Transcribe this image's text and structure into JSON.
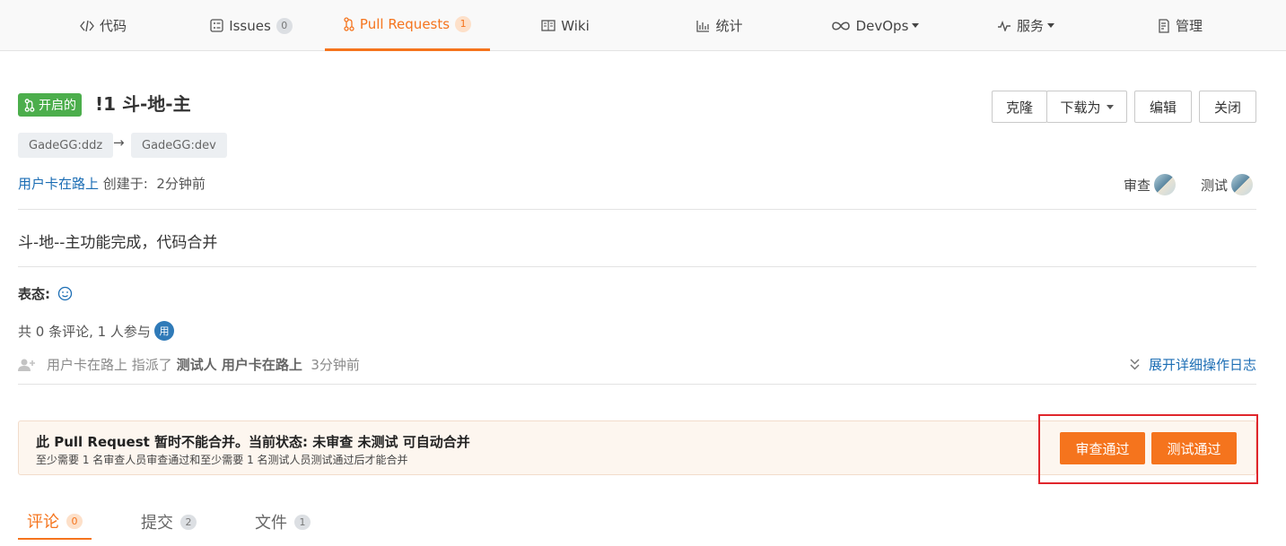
{
  "nav": {
    "code": "代码",
    "issues": "Issues",
    "issues_count": "0",
    "pulls": "Pull Requests",
    "pulls_count": "1",
    "wiki": "Wiki",
    "stats": "统计",
    "devops": "DevOps",
    "service": "服务",
    "manage": "管理"
  },
  "pr": {
    "status": "开启的",
    "title": "!1 斗-地-主",
    "source_branch": "GadeGG:ddz",
    "arrow": "→",
    "target_branch": "GadeGG:dev",
    "author": "用户卡在路上",
    "created_label": " 创建于:",
    "created_time": "2分钟前",
    "description": "斗-地--主功能完成，代码合并"
  },
  "actions": {
    "clone": "克隆",
    "download": "下载为",
    "edit": "编辑",
    "close": "关闭"
  },
  "reviewers": {
    "review_label": "审查",
    "test_label": "测试"
  },
  "reactions": {
    "label": "表态:"
  },
  "participants": {
    "text": "共 0 条评论, 1 人参与",
    "avatar_letter": "用"
  },
  "activity": {
    "actor": "用户卡在路上",
    "verb": "指派了",
    "target": "测试人 用户卡在路上",
    "time": "3分钟前",
    "expand": "展开详细操作日志"
  },
  "merge": {
    "title": "此 Pull Request 暂时不能合并。当前状态: 未审查 未测试 可自动合并",
    "subtitle": "至少需要 1 名审查人员审查通过和至少需要 1 名测试人员测试通过后才能合并",
    "approve_review": "审查通过",
    "approve_test": "测试通过"
  },
  "tabs": {
    "comments": "评论",
    "comments_count": "0",
    "commits": "提交",
    "commits_count": "2",
    "files": "文件",
    "files_count": "1"
  },
  "colors": {
    "accent": "#f5741d",
    "open_status": "#4cae4c",
    "link": "#1b6db4",
    "highlight_frame": "#e0262c"
  }
}
